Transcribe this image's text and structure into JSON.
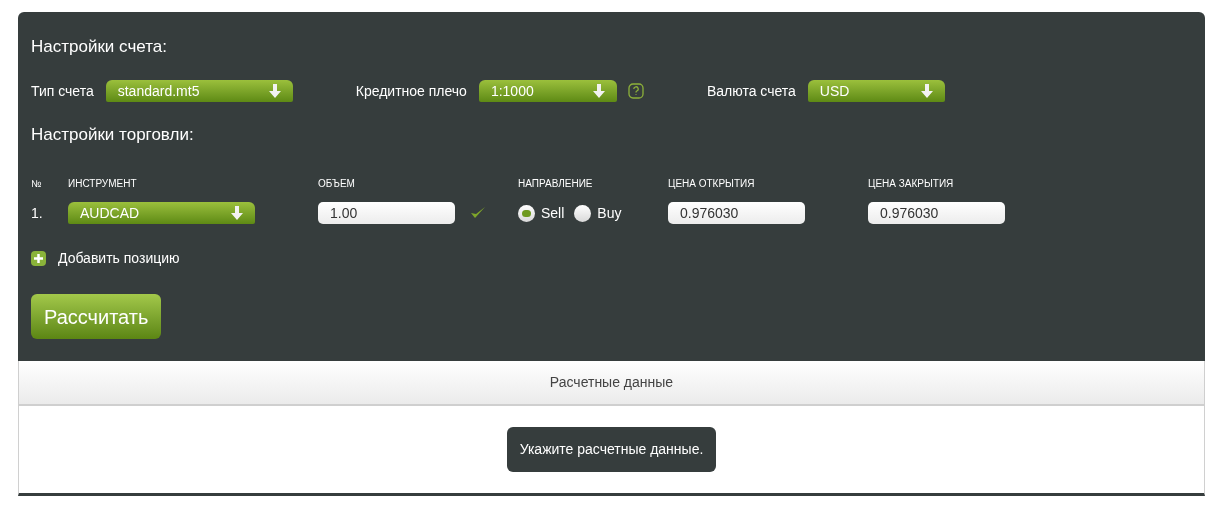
{
  "account_settings": {
    "title": "Настройки счета:",
    "fields": [
      {
        "label": "Тип счета",
        "value": "standard.mt5",
        "help": false
      },
      {
        "label": "Кредитное плечо",
        "value": "1:1000",
        "help": true
      },
      {
        "label": "Валюта счета",
        "value": "USD",
        "help": false
      }
    ]
  },
  "trade_settings": {
    "title": "Настройки торговли:",
    "columns": [
      "№",
      "ИНСТРУМЕНТ",
      "ОБЪЕМ",
      "НАПРАВЛЕНИЕ",
      "ЦЕНА ОТКРЫТИЯ",
      "ЦЕНА ЗАКРЫТИЯ"
    ],
    "rows": [
      {
        "number": "1.",
        "instrument": "AUDCAD",
        "volume": "1.00",
        "volume_valid": true,
        "directions": [
          {
            "label": "Sell",
            "selected": true
          },
          {
            "label": "Buy",
            "selected": false
          }
        ],
        "open_price": "0.976030",
        "close_price": "0.976030"
      }
    ],
    "add_position": "Добавить позицию"
  },
  "calculate_button": "Рассчитать",
  "results": {
    "title": "Расчетные данные",
    "message": "Укажите расчетные данные."
  }
}
